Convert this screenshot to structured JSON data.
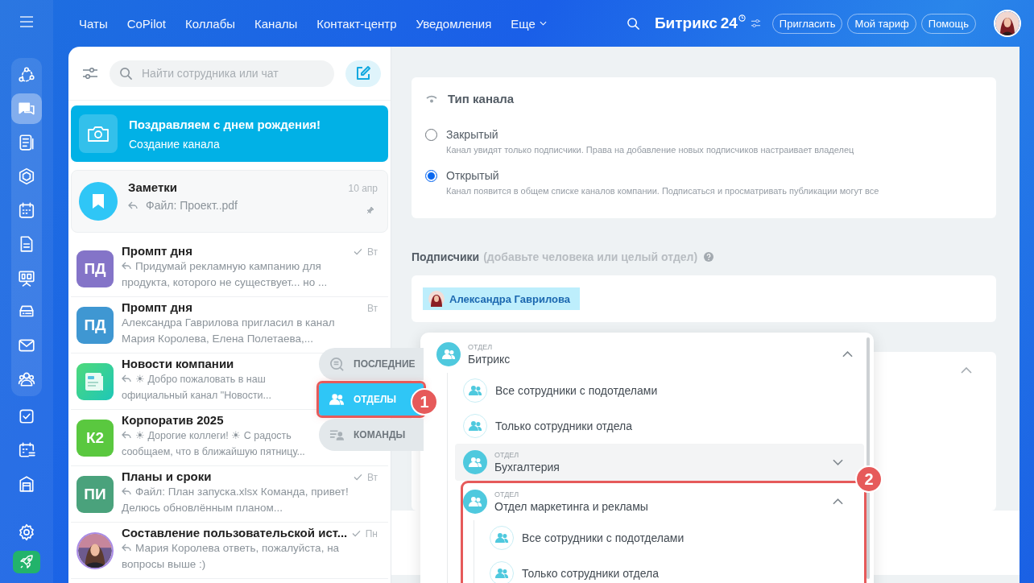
{
  "rail": {
    "group": [
      {
        "selected": false
      },
      {
        "selected": true
      },
      {
        "selected": false
      },
      {
        "selected": false
      },
      {
        "selected": false
      },
      {
        "selected": false
      },
      {
        "selected": false
      },
      {
        "selected": false
      },
      {
        "selected": false
      },
      {
        "selected": false
      }
    ],
    "rest": [
      {
        "selected": false
      },
      {
        "selected": false
      },
      {
        "selected": false
      }
    ]
  },
  "topbar": {
    "menu": [
      {
        "label": "Чаты"
      },
      {
        "label": "CoPilot"
      },
      {
        "label": "Коллабы"
      },
      {
        "label": "Каналы"
      },
      {
        "label": "Контакт-центр"
      },
      {
        "label": "Уведомления"
      }
    ],
    "more": "Еще",
    "logo": "Битрикс",
    "logo_number": "24",
    "buttons": [
      "Пригласить",
      "Мой тариф",
      "Помощь"
    ]
  },
  "chat_list": {
    "search": {
      "placeholder": "Найти сотрудника или чат"
    },
    "chats": [
      {
        "kind": "banner",
        "title": "Поздравляем с днем рождения!",
        "preview": "Создание канала",
        "selected": true
      },
      {
        "kind": "notes",
        "title": "Заметки",
        "preview": "Файл: Проект..pdf",
        "reply": true,
        "time": "10 апр",
        "pinned": true
      },
      {
        "kind": "initials",
        "initials": "ПД",
        "color": "#8474c8",
        "title": "Промпт дня",
        "preview": "Придумай рекламную кампанию для продукта, которого не существует... но ...",
        "reply": true,
        "time": "Вт",
        "read": true
      },
      {
        "kind": "initials",
        "initials": "ПД",
        "color": "#3f97d2",
        "title": "Промпт дня",
        "preview": "Александра Гаврилова пригласил в канал Мария Королева, Елена Полетаева,...",
        "reply": false,
        "time": "Вт",
        "read": false
      },
      {
        "kind": "news",
        "title": "Новости компании",
        "preview": "☀ Добро пожаловать в наш официальный канал \"Новости...",
        "reply": true
      },
      {
        "kind": "initials",
        "initials": "К2",
        "color": "#5ac83f",
        "title": "Корпоратив 2025",
        "preview": "☀ Дорогие коллеги! ☀ С радость",
        "preview_2": "сообщаем, что в ближайшую пятницу...",
        "reply": true
      },
      {
        "kind": "initials",
        "initials": "ПИ",
        "color": "#4aa27c",
        "title": "Планы и сроки",
        "preview": "Файл: План запуска.xlsx Команда, привет! Делюсь обновлённым планом...",
        "reply": true,
        "time": "Вт",
        "read": true
      },
      {
        "title": "Составление пользовательской ист...",
        "preview": "Мария Королева ответь, пожалуйста, на вопросы выше :)",
        "reply": true,
        "time": "Пн",
        "read": true
      }
    ]
  },
  "filter_tabs": [
    {
      "label": "ПОСЛЕДНИЕ",
      "selected": false
    },
    {
      "label": "ОТДЕЛЫ",
      "selected": true,
      "callout": "1"
    },
    {
      "label": "КОМАНДЫ",
      "selected": false
    }
  ],
  "channel_type": {
    "title": "Тип канала",
    "options": [
      {
        "label": "Закрытый",
        "description": "Канал увидят только подписчики. Права на добавление новых подписчиков настраивает владелец",
        "selected": false
      },
      {
        "label": "Открытый",
        "description": "Канал появится в общем списке каналов компании. Подписаться и просматривать публикации могут все",
        "selected": true
      }
    ]
  },
  "subscribers": {
    "label": "Подписчики",
    "hint": "(добавьте человека или целый отдел)",
    "chips": [
      {
        "name": "Александра Гаврилова"
      }
    ]
  },
  "picker": {
    "departments": [
      {
        "caption": "ОТДЕЛ",
        "name": "Битрикс",
        "expanded": true,
        "children": [
          {
            "kind": "option",
            "label": "Все сотрудники с подотделами"
          },
          {
            "kind": "option",
            "label": "Только сотрудники отдела"
          },
          {
            "kind": "department",
            "caption": "ОТДЕЛ",
            "name": "Бухгалтерия",
            "expanded": false,
            "hovered": true
          },
          {
            "kind": "department",
            "caption": "ОТДЕЛ",
            "name": "Отдел маркетинга и рекламы",
            "expanded": true,
            "hovered": false,
            "callout": "2",
            "children": [
              {
                "kind": "option",
                "label": "Все сотрудники с подотделами"
              },
              {
                "kind": "option",
                "label": "Только сотрудники отдела"
              }
            ]
          }
        ]
      }
    ]
  }
}
